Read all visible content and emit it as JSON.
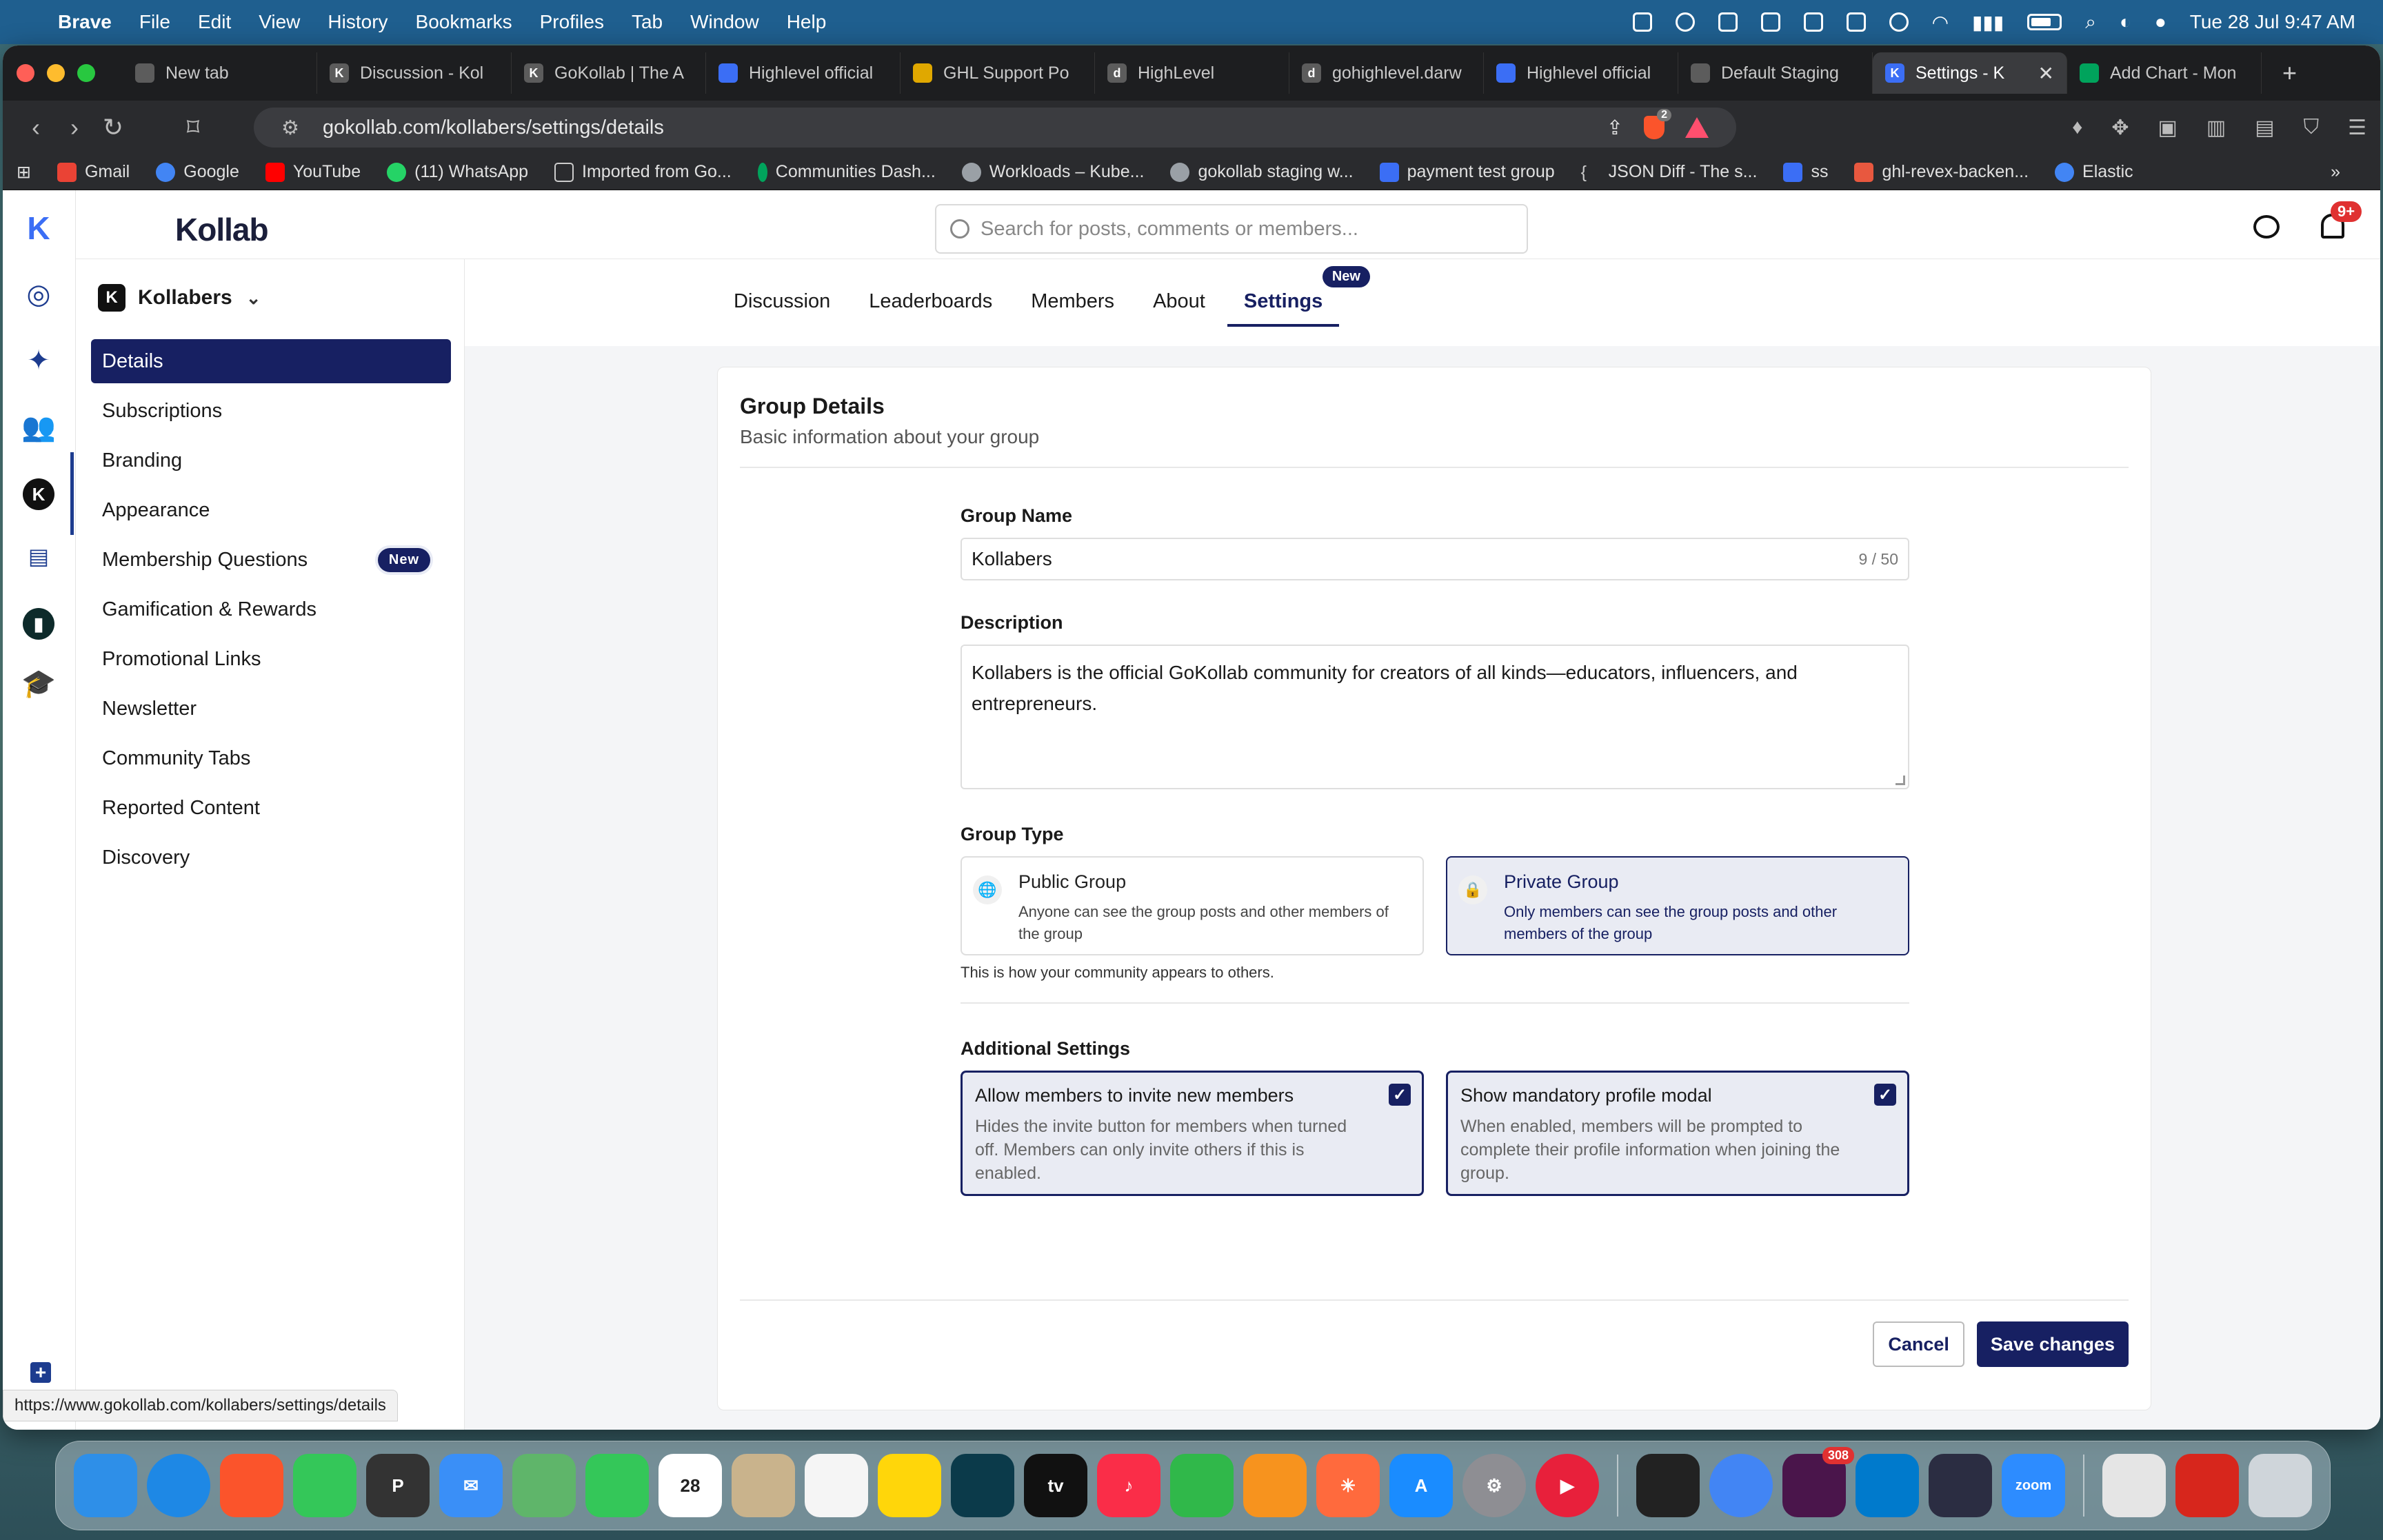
{
  "menubar": {
    "app_name": "Brave",
    "items": [
      "File",
      "Edit",
      "View",
      "History",
      "Bookmarks",
      "Profiles",
      "Tab",
      "Window",
      "Help"
    ],
    "datetime": "Tue 28 Jul  9:47 AM"
  },
  "tabs": [
    {
      "label": "New tab",
      "icon": "brave-shield-icon"
    },
    {
      "label": "Discussion - Kol",
      "icon": "kollab-icon"
    },
    {
      "label": "GoKollab | The A",
      "icon": "kollab-icon"
    },
    {
      "label": "Highlevel official",
      "icon": "highlevel-icon"
    },
    {
      "label": "GHL Support Po",
      "icon": "ghl-icon"
    },
    {
      "label": "HighLevel",
      "icon": "d-icon"
    },
    {
      "label": "gohighlevel.darw",
      "icon": "d-icon"
    },
    {
      "label": "Highlevel official",
      "icon": "highlevel-icon"
    },
    {
      "label": "Default Staging",
      "icon": "staging-icon"
    },
    {
      "label": "Settings - K",
      "icon": "kollab-icon",
      "active": true
    },
    {
      "label": "Add Chart - Mon",
      "icon": "mongo-icon"
    }
  ],
  "url": "gokollab.com/kollabers/settings/details",
  "shield_count": "2",
  "bookmarks": [
    {
      "label": "Gmail",
      "color": "#ea4335"
    },
    {
      "label": "Google",
      "color": "#4285f4"
    },
    {
      "label": "YouTube",
      "color": "#ff0000"
    },
    {
      "label": "(11) WhatsApp",
      "color": "#25d366"
    },
    {
      "label": "Imported from Go...",
      "color": "#888888"
    },
    {
      "label": "Communities Dash...",
      "color": "#00a35c"
    },
    {
      "label": "Workloads – Kube...",
      "color": "#9aa0a6"
    },
    {
      "label": "gokollab staging w...",
      "color": "#9aa0a6"
    },
    {
      "label": "payment test group",
      "color": "#3b6ef5"
    },
    {
      "label": "JSON Diff - The s...",
      "color": "#666666"
    },
    {
      "label": "ss",
      "color": "#3b6ef5"
    },
    {
      "label": "ghl-revex-backen...",
      "color": "#e8583f"
    },
    {
      "label": "Elastic",
      "color": "#f2c94c"
    }
  ],
  "header": {
    "logo": "Kollab",
    "search_placeholder": "Search for posts, comments or members...",
    "notif_count": "9+"
  },
  "group": {
    "name": "Kollabers",
    "initial": "K"
  },
  "sidebar": {
    "items": [
      {
        "label": "Details",
        "active": true
      },
      {
        "label": "Subscriptions"
      },
      {
        "label": "Branding"
      },
      {
        "label": "Appearance"
      },
      {
        "label": "Membership Questions",
        "badge": "New"
      },
      {
        "label": "Gamification & Rewards"
      },
      {
        "label": "Promotional Links"
      },
      {
        "label": "Newsletter"
      },
      {
        "label": "Community Tabs"
      },
      {
        "label": "Reported Content"
      },
      {
        "label": "Discovery"
      }
    ]
  },
  "nav_tabs": [
    {
      "label": "Discussion"
    },
    {
      "label": "Leaderboards"
    },
    {
      "label": "Members"
    },
    {
      "label": "About"
    },
    {
      "label": "Settings",
      "active": true,
      "badge": "New"
    }
  ],
  "card": {
    "title": "Group Details",
    "subtitle": "Basic information about your group"
  },
  "form": {
    "group_name_label": "Group Name",
    "group_name_value": "Kollabers",
    "group_name_count": "9 / 50",
    "description_label": "Description",
    "description_value": "Kollabers is the official GoKollab community for creators of all kinds—educators, influencers, and entrepreneurs.",
    "group_type_label": "Group Type",
    "public": {
      "title": "Public Group",
      "desc": "Anyone can see the group posts and other members of the group"
    },
    "private": {
      "title": "Private Group",
      "desc": "Only members can see the group posts and other members of the group"
    },
    "group_type_hint": "This is how your community appears to others.",
    "additional_label": "Additional Settings",
    "invite": {
      "title": "Allow members to invite new members",
      "desc": "Hides the invite button for members when turned off. Members can only invite others if this is enabled.",
      "checked": true
    },
    "profile_modal": {
      "title": "Show mandatory profile modal",
      "desc": "When enabled, members will be prompted to complete their profile information when joining the group.",
      "checked": true
    }
  },
  "buttons": {
    "cancel": "Cancel",
    "save": "Save changes"
  },
  "status_url": "https://www.gokollab.com/kollabers/settings/details",
  "dock_badges": {
    "slack": "308"
  },
  "colors": {
    "primary": "#172062",
    "accent": "#1d3c8f",
    "badge_red": "#e03131"
  }
}
